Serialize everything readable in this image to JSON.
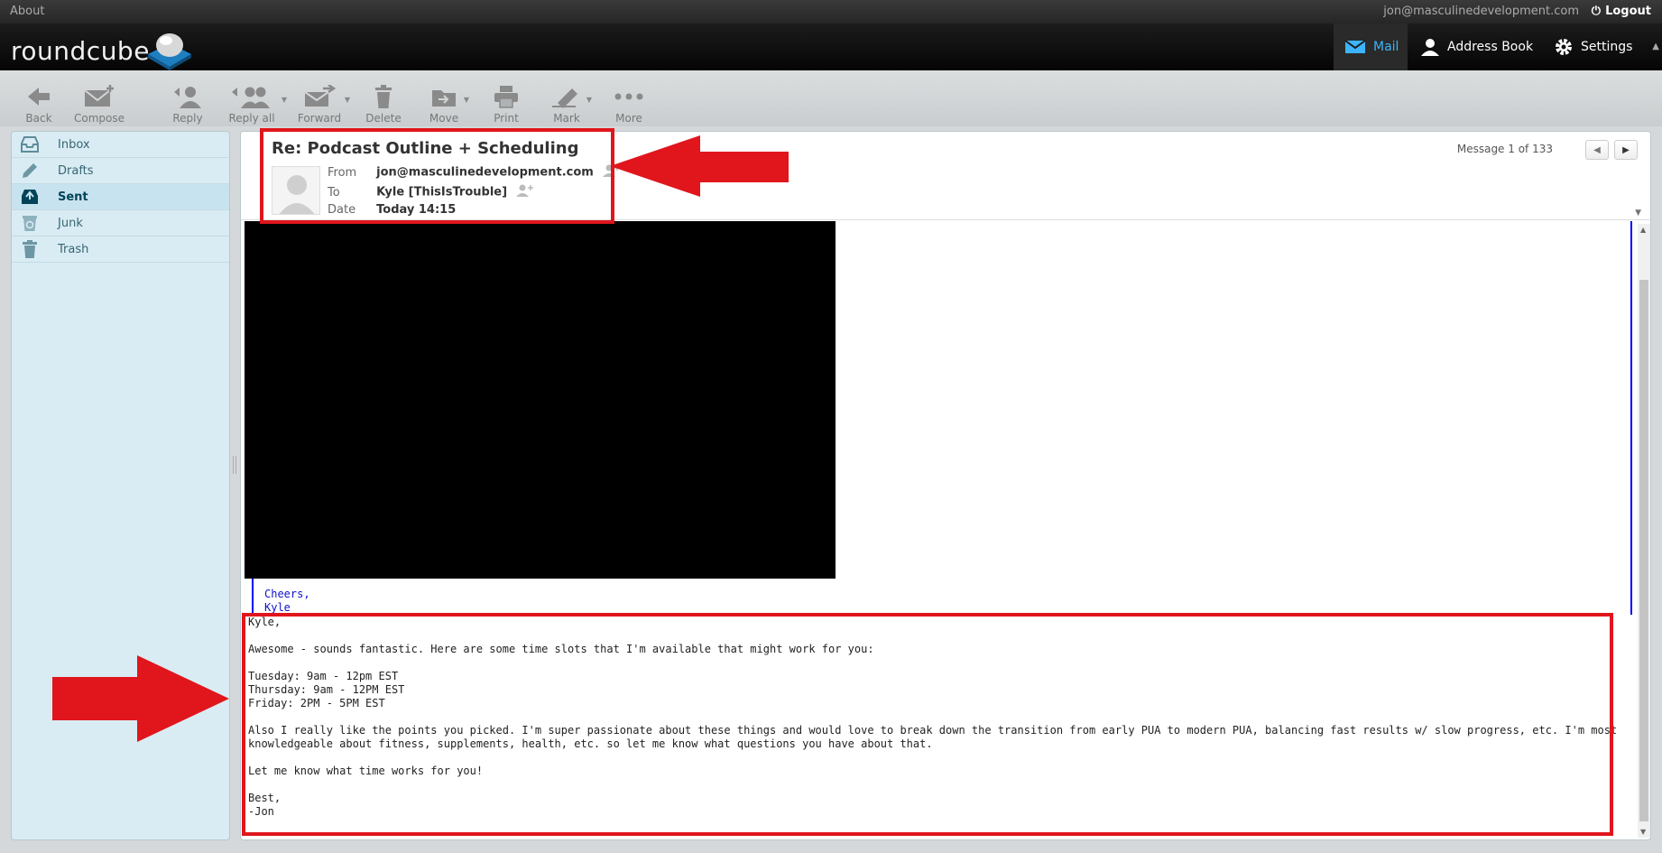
{
  "topbar": {
    "about": "About",
    "user_email": "jon@masculinedevelopment.com",
    "logout": "Logout"
  },
  "app": {
    "logo_text": "roundcube"
  },
  "nav": {
    "mail": "Mail",
    "address_book": "Address Book",
    "settings": "Settings"
  },
  "toolbar": {
    "back": "Back",
    "compose": "Compose",
    "reply": "Reply",
    "reply_all": "Reply all",
    "forward": "Forward",
    "delete": "Delete",
    "move": "Move",
    "print": "Print",
    "mark": "Mark",
    "more": "More"
  },
  "folders": [
    {
      "label": "Inbox",
      "icon": "inbox-icon"
    },
    {
      "label": "Drafts",
      "icon": "pencil-icon"
    },
    {
      "label": "Sent",
      "icon": "sent-icon"
    },
    {
      "label": "Junk",
      "icon": "recycle-icon"
    },
    {
      "label": "Trash",
      "icon": "trash-icon"
    }
  ],
  "message": {
    "subject": "Re: Podcast Outline + Scheduling",
    "from_label": "From",
    "from": "jon@masculinedevelopment.com",
    "to_label": "To",
    "to": "Kyle [ThisIsTrouble]",
    "date_label": "Date",
    "date": "Today 14:15",
    "counter": "Message 1 of 133",
    "quote_text": "Cheers,\nKyle",
    "body": [
      "Kyle,",
      "",
      "Awesome - sounds fantastic. Here are some time slots that I'm available that might work for you:",
      "",
      "Tuesday: 9am - 12pm EST",
      "Thursday: 9am - 12PM EST",
      "Friday: 2PM - 5PM EST",
      "",
      "Also I really like the points you picked. I'm super passionate about these things and would love to break down the transition from early PUA to modern PUA, balancing fast results w/ slow progress, etc. I'm most knowledgeable about fitness, supplements, health, etc. so let me know what questions you have about that.",
      "",
      "Let me know what time works for you!",
      "",
      "Best,",
      "-Jon"
    ]
  },
  "colors": {
    "accent": "#3cb4ff",
    "annotation_red": "#e0161c",
    "quote_blue": "#0000ff"
  }
}
